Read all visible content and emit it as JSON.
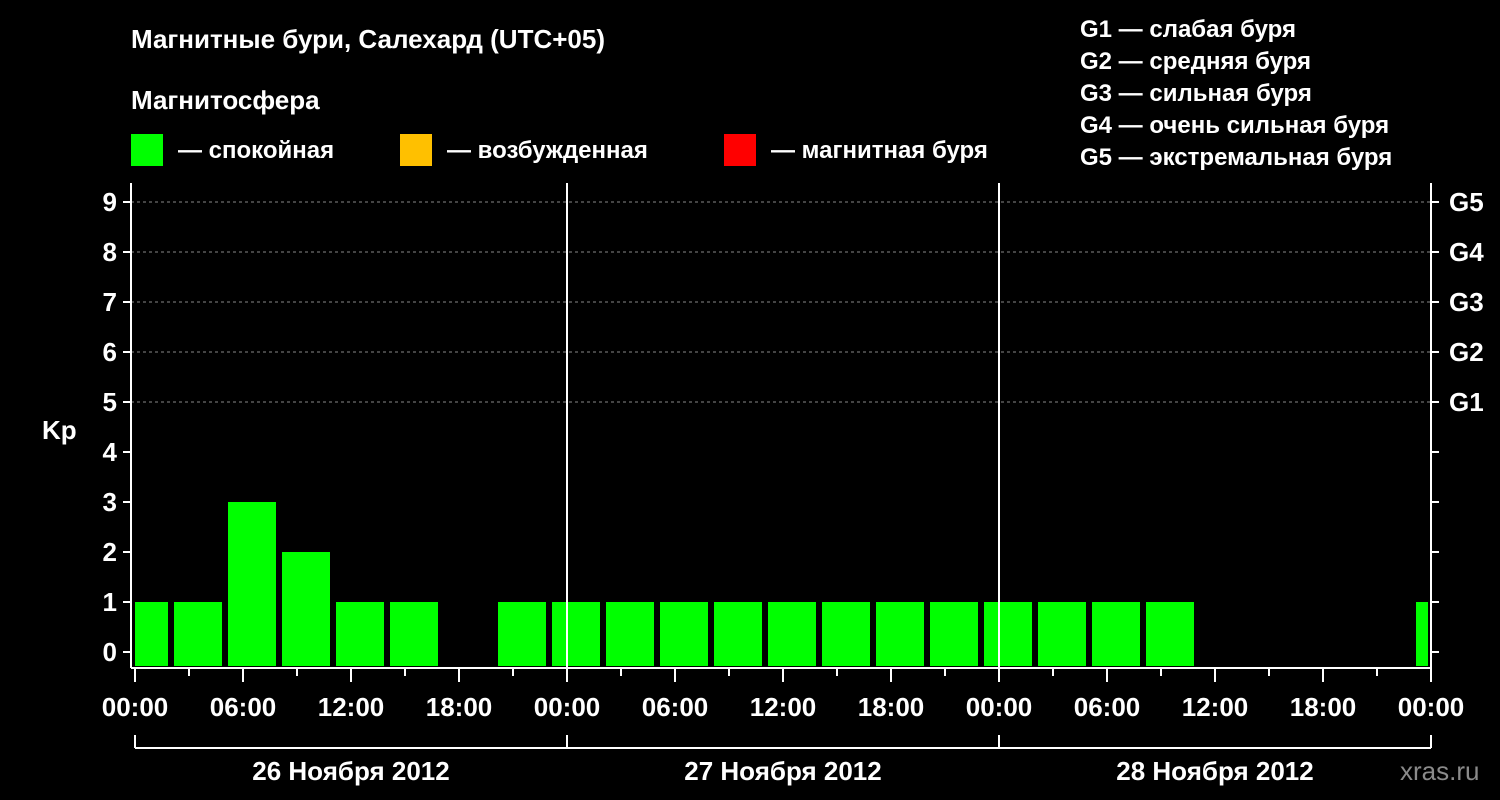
{
  "header": {
    "title": "Магнитные бури, Салехард (UTC+05)",
    "subtitle": "Магнитосфера"
  },
  "legend": [
    {
      "label": "— спокойная",
      "color": "#00ff00"
    },
    {
      "label": "— возбужденная",
      "color": "#ffc000"
    },
    {
      "label": "— магнитная буря",
      "color": "#ff0000"
    }
  ],
  "storm_scale": [
    "G1 — слабая буря",
    "G2 — средняя буря",
    "G3 — сильная буря",
    "G4 — очень сильная буря",
    "G5 — экстремальная буря"
  ],
  "watermark": "xras.ru",
  "colors": {
    "background": "#000000",
    "axis": "#ffffff",
    "grid": "#888888",
    "quiet": "#00ff00"
  },
  "chart_data": {
    "type": "bar",
    "ylabel": "Kp",
    "ylim": [
      0,
      9
    ],
    "yticks": [
      0,
      1,
      2,
      3,
      4,
      5,
      6,
      7,
      8,
      9
    ],
    "grid_dashed_y": [
      5,
      6,
      7,
      8,
      9
    ],
    "right_labels": [
      {
        "value": 5,
        "label": "G1"
      },
      {
        "value": 6,
        "label": "G2"
      },
      {
        "value": 7,
        "label": "G3"
      },
      {
        "value": 8,
        "label": "G4"
      },
      {
        "value": 9,
        "label": "G5"
      }
    ],
    "xlim_hours": [
      0,
      72
    ],
    "xticks": [
      {
        "hour": 0,
        "label": "00:00"
      },
      {
        "hour": 6,
        "label": "06:00"
      },
      {
        "hour": 12,
        "label": "12:00"
      },
      {
        "hour": 18,
        "label": "18:00"
      },
      {
        "hour": 24,
        "label": "00:00"
      },
      {
        "hour": 30,
        "label": "06:00"
      },
      {
        "hour": 36,
        "label": "12:00"
      },
      {
        "hour": 42,
        "label": "18:00"
      },
      {
        "hour": 48,
        "label": "00:00"
      },
      {
        "hour": 54,
        "label": "06:00"
      },
      {
        "hour": 60,
        "label": "12:00"
      },
      {
        "hour": 66,
        "label": "18:00"
      },
      {
        "hour": 72,
        "label": "00:00"
      }
    ],
    "day_separators_hours": [
      24,
      48
    ],
    "days": [
      {
        "label": "26 Ноября 2012",
        "start": 0,
        "end": 24
      },
      {
        "label": "27 Ноября 2012",
        "start": 24,
        "end": 48
      },
      {
        "label": "28 Ноября 2012",
        "start": 48,
        "end": 72
      }
    ],
    "bars": [
      {
        "start": 0,
        "end": 2,
        "kp": 1,
        "level": "quiet"
      },
      {
        "start": 2,
        "end": 5,
        "kp": 1,
        "level": "quiet"
      },
      {
        "start": 5,
        "end": 8,
        "kp": 3,
        "level": "quiet"
      },
      {
        "start": 8,
        "end": 11,
        "kp": 2,
        "level": "quiet"
      },
      {
        "start": 11,
        "end": 14,
        "kp": 1,
        "level": "quiet"
      },
      {
        "start": 14,
        "end": 17,
        "kp": 1,
        "level": "quiet"
      },
      {
        "start": 20,
        "end": 23,
        "kp": 1,
        "level": "quiet"
      },
      {
        "start": 23,
        "end": 26,
        "kp": 1,
        "level": "quiet"
      },
      {
        "start": 26,
        "end": 29,
        "kp": 1,
        "level": "quiet"
      },
      {
        "start": 29,
        "end": 32,
        "kp": 1,
        "level": "quiet"
      },
      {
        "start": 32,
        "end": 35,
        "kp": 1,
        "level": "quiet"
      },
      {
        "start": 35,
        "end": 38,
        "kp": 1,
        "level": "quiet"
      },
      {
        "start": 38,
        "end": 41,
        "kp": 1,
        "level": "quiet"
      },
      {
        "start": 41,
        "end": 44,
        "kp": 1,
        "level": "quiet"
      },
      {
        "start": 44,
        "end": 47,
        "kp": 1,
        "level": "quiet"
      },
      {
        "start": 47,
        "end": 50,
        "kp": 1,
        "level": "quiet"
      },
      {
        "start": 50,
        "end": 53,
        "kp": 1,
        "level": "quiet"
      },
      {
        "start": 53,
        "end": 56,
        "kp": 1,
        "level": "quiet"
      },
      {
        "start": 56,
        "end": 59,
        "kp": 1,
        "level": "quiet"
      },
      {
        "start": 71,
        "end": 72,
        "kp": 1,
        "level": "quiet"
      }
    ]
  }
}
